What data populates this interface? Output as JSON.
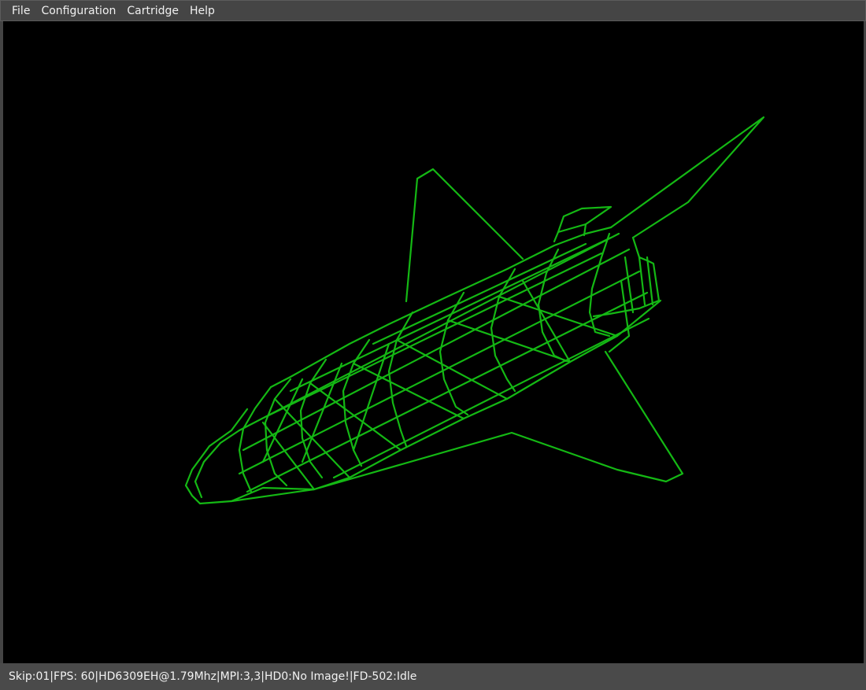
{
  "menubar": {
    "items": [
      {
        "label": "File"
      },
      {
        "label": "Configuration"
      },
      {
        "label": "Cartridge"
      },
      {
        "label": "Help"
      }
    ]
  },
  "screen": {
    "background": "#000000",
    "wireframe_color": "#14b814"
  },
  "statusbar": {
    "text": "Skip:01|FPS: 60|HD6309EH@1.79Mhz|MPI:3,3|HD0:No Image!|FD-502:Idle"
  }
}
